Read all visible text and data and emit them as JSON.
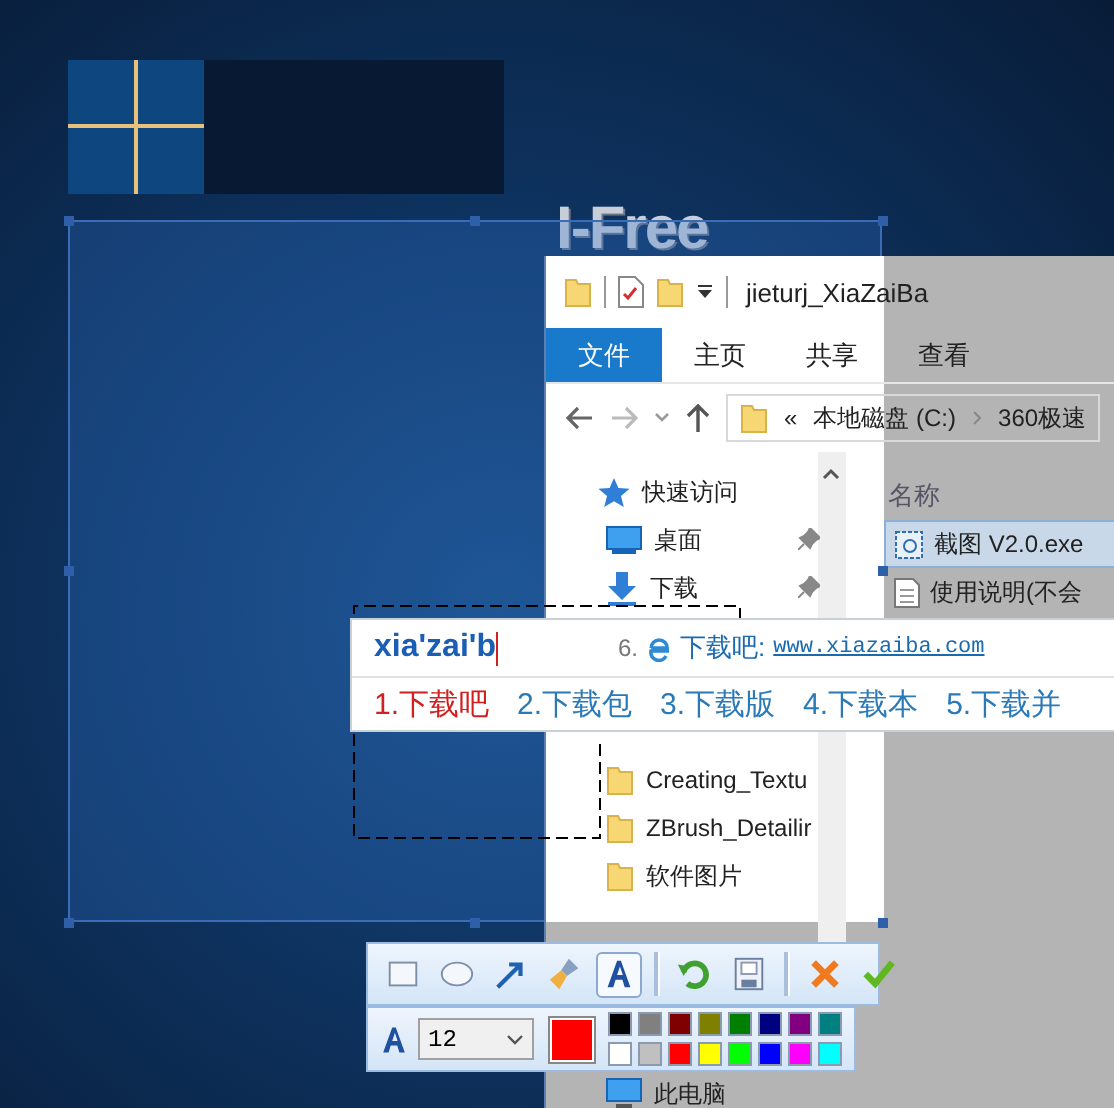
{
  "logo_text": "I-Free",
  "explorer": {
    "title": "jieturj_XiaZaiBa",
    "ribbon_tabs": [
      {
        "label": "文件",
        "selected": true
      },
      {
        "label": "主页",
        "selected": false
      },
      {
        "label": "共享",
        "selected": false
      },
      {
        "label": "查看",
        "selected": false
      }
    ],
    "address": {
      "overflow": "«",
      "parts": [
        "本地磁盘 (C:)",
        "360极速"
      ]
    },
    "nav_pane": [
      {
        "label": "快速访问",
        "kind": "star",
        "pinned": false
      },
      {
        "label": "桌面",
        "kind": "desktop",
        "pinned": true
      },
      {
        "label": "下载",
        "kind": "download",
        "pinned": true
      },
      {
        "label": "Creating_Textu",
        "kind": "folder",
        "pinned": false
      },
      {
        "label": "ZBrush_Detailir",
        "kind": "folder",
        "pinned": false
      },
      {
        "label": "软件图片",
        "kind": "folder",
        "pinned": false
      },
      {
        "label": "此电脑",
        "kind": "pc",
        "pinned": false
      }
    ],
    "column_header": "名称",
    "files": [
      {
        "name": "截图 V2.0.exe",
        "kind": "exe",
        "selected": true
      },
      {
        "name": "使用说明(不会",
        "kind": "doc",
        "selected": false
      }
    ]
  },
  "ime": {
    "composition": "xia'zai'b",
    "suggestion_index": "6.",
    "suggestion_label": "下载吧:",
    "suggestion_url": "www.xiazaiba.com",
    "candidates": [
      {
        "label": "1.下载吧",
        "selected": true
      },
      {
        "label": "2.下载包",
        "selected": false
      },
      {
        "label": "3.下载版",
        "selected": false
      },
      {
        "label": "4.下载本",
        "selected": false
      },
      {
        "label": "5.下载并",
        "selected": false
      }
    ]
  },
  "toolbar": {
    "tools": [
      {
        "kind": "rectangle",
        "separator_before": false,
        "selected": false
      },
      {
        "kind": "ellipse",
        "separator_before": false,
        "selected": false
      },
      {
        "kind": "arrow",
        "separator_before": false,
        "selected": false
      },
      {
        "kind": "brush",
        "separator_before": false,
        "selected": false
      },
      {
        "kind": "text",
        "separator_before": false,
        "selected": true
      },
      {
        "kind": "undo",
        "separator_before": true,
        "selected": false
      },
      {
        "kind": "save",
        "separator_before": false,
        "selected": false
      },
      {
        "kind": "cancel",
        "separator_before": true,
        "selected": false
      },
      {
        "kind": "confirm",
        "separator_before": false,
        "selected": false
      }
    ],
    "font_size": "12",
    "palette": [
      {
        "color": "#000000",
        "selected": false
      },
      {
        "color": "#808080",
        "selected": false
      },
      {
        "color": "#800000",
        "selected": false
      },
      {
        "color": "#808000",
        "selected": false
      },
      {
        "color": "#008000",
        "selected": false
      },
      {
        "color": "#000080",
        "selected": false
      },
      {
        "color": "#800080",
        "selected": false
      },
      {
        "color": "#008080",
        "selected": false
      },
      {
        "color": "#ffffff",
        "selected": false
      },
      {
        "color": "#c0c0c0",
        "selected": false
      },
      {
        "color": "#ff0000",
        "selected": true
      },
      {
        "color": "#ffff00",
        "selected": false
      },
      {
        "color": "#00ff00",
        "selected": false
      },
      {
        "color": "#0000ff",
        "selected": false
      },
      {
        "color": "#ff00ff",
        "selected": false
      },
      {
        "color": "#00ffff",
        "selected": false
      }
    ]
  }
}
